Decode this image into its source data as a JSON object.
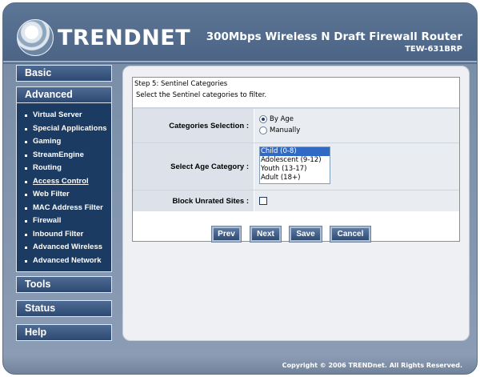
{
  "header": {
    "brand": "TRENDNET",
    "product_title": "300Mbps Wireless N Draft Firewall Router",
    "model": "TEW-631BRP"
  },
  "nav": {
    "basic": "Basic",
    "advanced": "Advanced",
    "tools": "Tools",
    "status": "Status",
    "help": "Help",
    "advanced_items": [
      "Virtual Server",
      "Special Applications",
      "Gaming",
      "StreamEngine",
      "Routing",
      "Access Control",
      "Web Filter",
      "MAC Address Filter",
      "Firewall",
      "Inbound Filter",
      "Advanced Wireless",
      "Advanced Network"
    ],
    "active_item": "Access Control"
  },
  "form": {
    "step_title": "Step 5: Sentinel Categories",
    "description": "Select the Sentinel categories to filter.",
    "categories_label": "Categories Selection :",
    "radio_by_age": "By Age",
    "radio_manually": "Manually",
    "selected_radio": "By Age",
    "age_label": "Select Age Category :",
    "age_options": [
      "Child (0-8)",
      "Adolescent (9-12)",
      "Youth (13-17)",
      "Adult (18+)"
    ],
    "selected_age": "Child (0-8)",
    "block_label": "Block Unrated Sites :",
    "block_checked": false
  },
  "buttons": {
    "prev": "Prev",
    "next": "Next",
    "save": "Save",
    "cancel": "Cancel"
  },
  "footer": {
    "copyright": "Copyright © 2006 TRENDnet. All Rights Reserved."
  }
}
